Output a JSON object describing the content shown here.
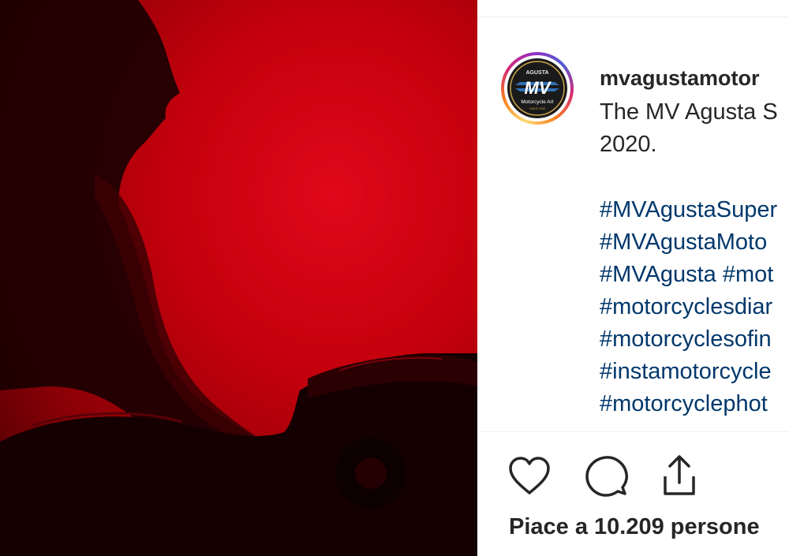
{
  "post": {
    "username": "mvagustamotor",
    "caption_lines": [
      "The MV Agusta S",
      "2020."
    ],
    "hashtag_lines": [
      "#MVAgustaSuper",
      "#MVAgustaMoto",
      "#MVAgusta #mot",
      "#motorcyclesdiar",
      "#motorcyclesofin",
      "#instamotorcycle",
      "#motorcyclephot"
    ],
    "likes_text": "Piace a 10.209 persone"
  },
  "avatar": {
    "logo_top_text": "AGUSTA",
    "logo_mark": "MV",
    "logo_bottom_text": "Motorcycle Art",
    "logo_small_text": "SINCE 1945"
  },
  "actions": {
    "icons": [
      "heart-icon",
      "comment-icon",
      "share-icon"
    ]
  },
  "colors": {
    "photo_red": "#c4000c",
    "hashtag": "#00376b",
    "text": "#262626"
  }
}
